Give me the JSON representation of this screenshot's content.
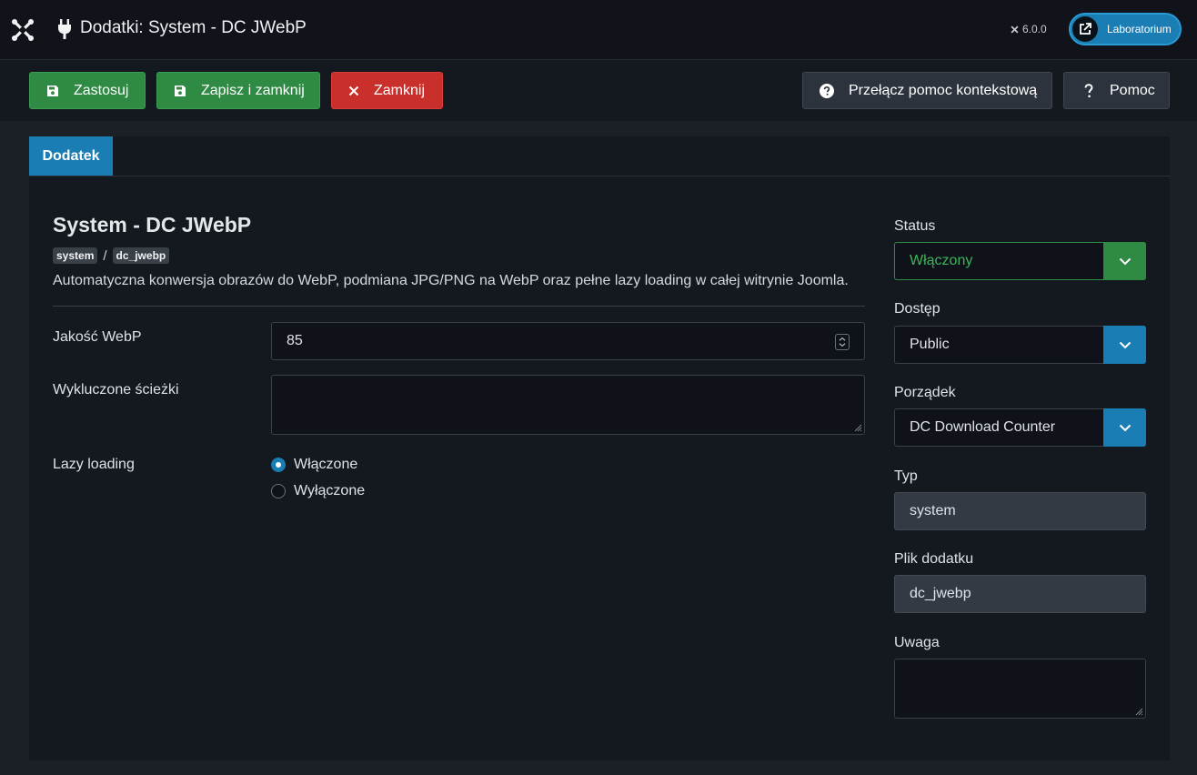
{
  "header": {
    "title": "Dodatki: System - DC JWebP",
    "version": "6.0.0",
    "site_button_label": "Laboratorium"
  },
  "toolbar": {
    "apply_label": "Zastosuj",
    "save_close_label": "Zapisz i zamknij",
    "close_label": "Zamknij",
    "toggle_help_label": "Przełącz pomoc kontekstową",
    "help_label": "Pomoc"
  },
  "tabs": [
    {
      "label": "Dodatek",
      "active": true
    }
  ],
  "plugin": {
    "name": "System - DC JWebP",
    "folder_badge": "system",
    "element_badge": "dc_jwebp",
    "separator": "/",
    "description": "Automatyczna konwersja obrazów do WebP, podmiana JPG/PNG na WebP oraz pełne lazy loading w całej witrynie Joomla."
  },
  "form": {
    "quality_label": "Jakość WebP",
    "quality_value": "85",
    "excluded_label": "Wykluczone ścieżki",
    "excluded_value": "",
    "lazy_label": "Lazy loading",
    "lazy_options": [
      {
        "label": "Włączone",
        "checked": true
      },
      {
        "label": "Wyłączone",
        "checked": false
      }
    ]
  },
  "sidebar": {
    "status_label": "Status",
    "status_value": "Włączony",
    "access_label": "Dostęp",
    "access_value": "Public",
    "ordering_label": "Porządek",
    "ordering_value": "DC Download Counter",
    "type_label": "Typ",
    "type_value": "system",
    "file_label": "Plik dodatku",
    "file_value": "dc_jwebp",
    "note_label": "Uwaga",
    "note_value": ""
  },
  "colors": {
    "accent": "#1a7db3",
    "success": "#2f8a44",
    "danger": "#c9302c",
    "status_text": "#3fb45c"
  }
}
